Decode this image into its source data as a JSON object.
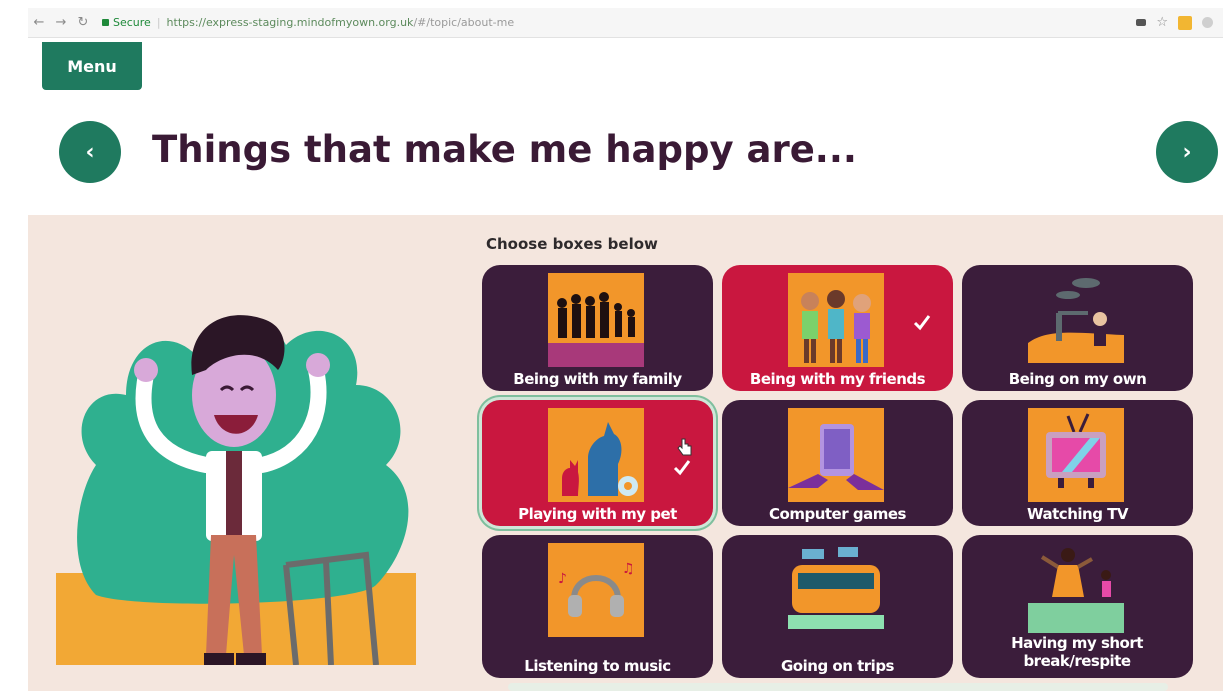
{
  "browser": {
    "secure_label": "Secure",
    "url_host": "https://express-staging.mindofmyown.org.uk",
    "url_path": "/#/topic/about-me"
  },
  "menu_label": "Menu",
  "title": "Things that make me happy are...",
  "instruction": "Choose boxes below",
  "tiles": [
    {
      "label": "Being with my family",
      "selected": false,
      "icon": "family-silhouette-icon"
    },
    {
      "label": "Being with my friends",
      "selected": true,
      "icon": "friends-icon"
    },
    {
      "label": "Being on my own",
      "selected": false,
      "icon": "alone-icon"
    },
    {
      "label": "Playing with my pet",
      "selected": true,
      "icon": "pet-icon"
    },
    {
      "label": "Computer games",
      "selected": false,
      "icon": "tablet-icon"
    },
    {
      "label": "Watching TV",
      "selected": false,
      "icon": "tv-icon"
    },
    {
      "label": "Listening to music",
      "selected": false,
      "icon": "headphones-icon"
    },
    {
      "label": "Going on trips",
      "selected": false,
      "icon": "bus-icon"
    },
    {
      "label": "Having my short break/respite",
      "selected": false,
      "icon": "dancing-icon"
    }
  ],
  "colors": {
    "accent": "#1f7a5f",
    "tile_default": "#3b1d3b",
    "tile_selected": "#c9173f",
    "tile_image": "#f2962a",
    "panel_bg": "#f4e6de",
    "title_text": "#3a1a35"
  }
}
